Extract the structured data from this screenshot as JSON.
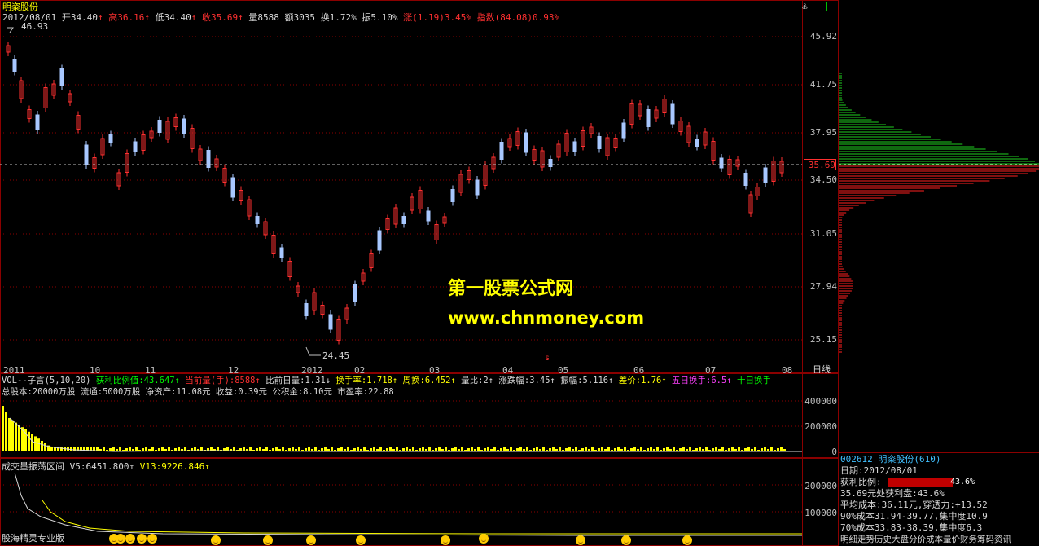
{
  "stock_name": "明粢股份",
  "header": {
    "date": "2012/08/01",
    "open_label": "开",
    "open": "34.40",
    "high_label": "高",
    "high": "36.16",
    "low_label": "低",
    "low": "34.40",
    "close_label": "收",
    "close": "35.69",
    "vol_label": "量",
    "vol": "8588",
    "amount_label": "额",
    "amount": "3035",
    "turnover_label": "换",
    "turnover": "1.72%",
    "amplitude_label": "振",
    "amplitude": "5.10%",
    "change_label": "涨",
    "change": "(1.19)3.45%",
    "index_label": "指数",
    "index": "(84.08)0.93%"
  },
  "price_axis": [
    "45.92",
    "41.75",
    "37.95",
    "34.50",
    "31.05",
    "27.94",
    "25.15"
  ],
  "current_price_tag": "35.69",
  "extremes": {
    "high": "46.93",
    "low": "24.45"
  },
  "months": [
    "2011",
    "10",
    "11",
    "12",
    "2012",
    "02",
    "03",
    "04",
    "05",
    "06",
    "07",
    "08"
  ],
  "period_label": "日线",
  "marker_s": "s",
  "vol_info": {
    "name": "VOL--子言(5,10,20)",
    "profit_ratio": "获利比例值:43.647↑",
    "current_vol": "当前量(手):8588↑",
    "vol_ratio": "比前日量:1.31↓",
    "turnover_rate": "换手率:1.718↑",
    "week_turnover": "周换:6.452↑",
    "qty_ratio": "量比:2↑",
    "updown": "涨跌幅:3.45↑",
    "amp": "振幅:5.116↑",
    "diff": "差价:1.76↑",
    "five_day": "五日换手:6.5↑",
    "ten_day": "十日换手",
    "fundamentals": "总股本:20000万股 流通:5000万股 净资产:11.08元 收益:0.39元 公积金:8.10元 市盈率:22.88"
  },
  "vol_axis": [
    "400000",
    "200000",
    "0"
  ],
  "osc_info": {
    "name": "成交量振荡区间",
    "v5": "V5:6451.800↑",
    "v13": "V13:9226.846↑"
  },
  "osc_axis": [
    "200000",
    "100000"
  ],
  "watermark": {
    "title": "第一股票公式网",
    "url": "www.chnmoney.com"
  },
  "bottom_left": "股海精灵专业版",
  "bottom_strip": "明细走势历史大盘分价成本量价财务筹码资讯",
  "right_panel": {
    "code_line": "002612 明粢股份(610)",
    "date_line": "日期:2012/08/01",
    "profit_label": "获利比例:",
    "profit_value": "43.6%",
    "profit_fraction": 0.436,
    "line1": "35.69元处获利盘:43.6%",
    "line2": "平均成本:36.11元,穿透力:+13.52",
    "line3": "90%成本31.94-39.77,集中度10.9",
    "line4": "70%成本33.83-38.39,集中度6.3"
  },
  "colors": {
    "up": "#ff3030",
    "down": "#a8c8ff",
    "grid": "#8b0000",
    "vol_up": "#ffff00"
  }
}
